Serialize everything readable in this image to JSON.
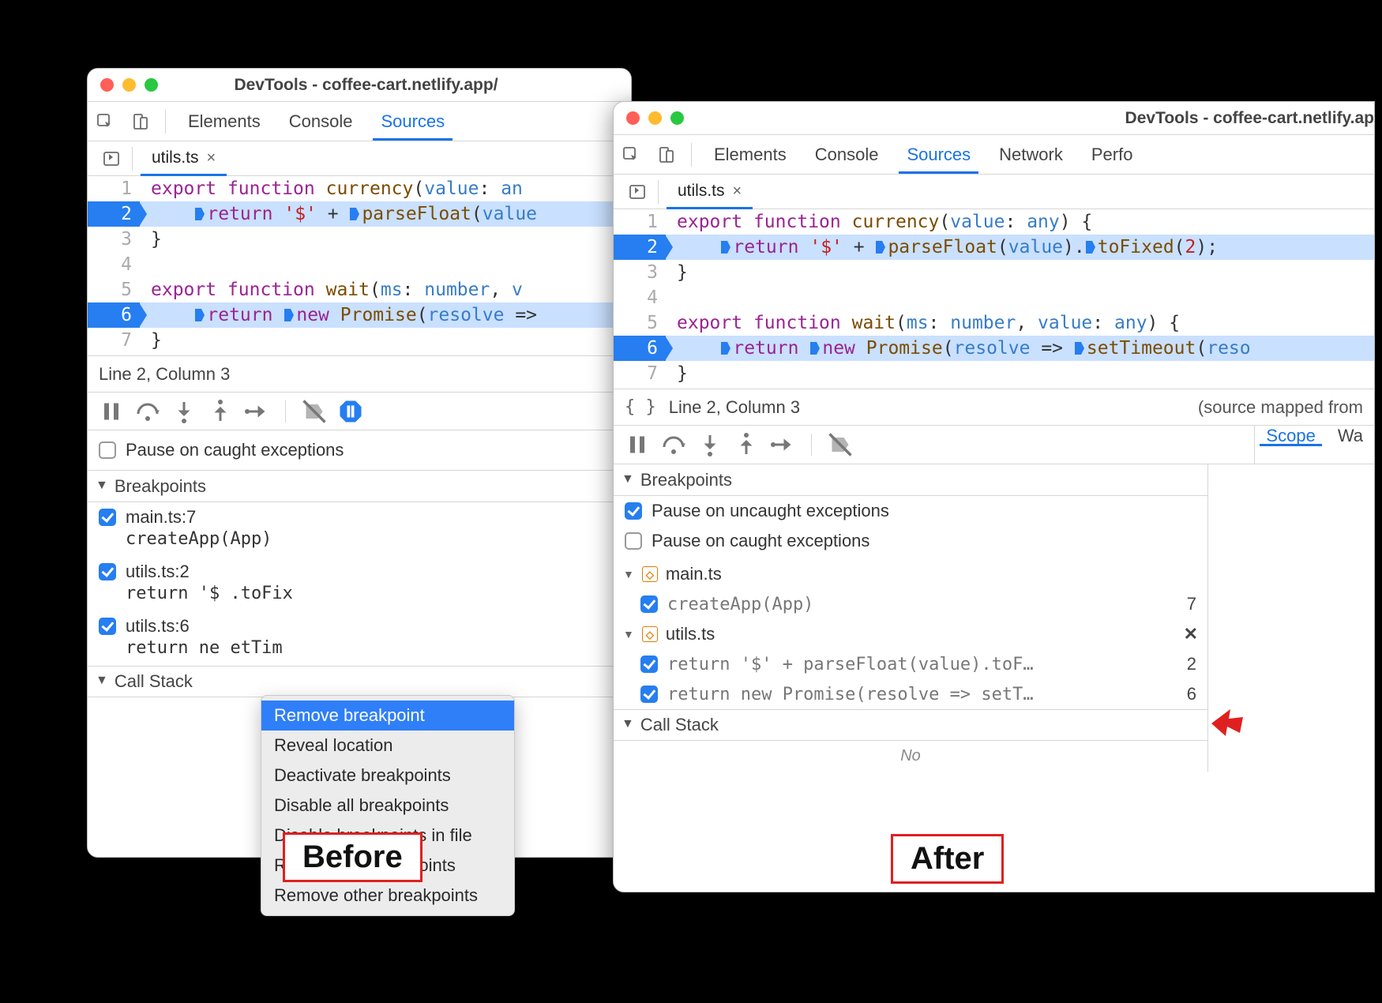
{
  "before": {
    "window_title": "DevTools - coffee-cart.netlify.app/",
    "top_tabs": [
      "Elements",
      "Console",
      "Sources"
    ],
    "active_top_tab": "Sources",
    "file_tab": "utils.ts",
    "code_lines": [
      {
        "n": 1,
        "bp": false,
        "tokens": [
          [
            "kw",
            "export"
          ],
          [
            "pn",
            " "
          ],
          [
            "kw",
            "function"
          ],
          [
            "pn",
            " "
          ],
          [
            "fn",
            "currency"
          ],
          [
            "pn",
            "("
          ],
          [
            "id2",
            "value"
          ],
          [
            "pn",
            ": "
          ],
          [
            "ty",
            "an"
          ]
        ]
      },
      {
        "n": 2,
        "bp": true,
        "tokens": [
          [
            "pn",
            "    "
          ],
          [
            "bpm",
            ""
          ],
          [
            "kw",
            "return"
          ],
          [
            "pn",
            " "
          ],
          [
            "str",
            "'$'"
          ],
          [
            "pn",
            " + "
          ],
          [
            "bpm",
            ""
          ],
          [
            "fn",
            "parseFloat"
          ],
          [
            "pn",
            "("
          ],
          [
            "id2",
            "value"
          ]
        ]
      },
      {
        "n": 3,
        "bp": false,
        "tokens": [
          [
            "pn",
            "}"
          ]
        ]
      },
      {
        "n": 4,
        "bp": false,
        "tokens": [
          [
            "pn",
            ""
          ]
        ]
      },
      {
        "n": 5,
        "bp": false,
        "tokens": [
          [
            "kw",
            "export"
          ],
          [
            "pn",
            " "
          ],
          [
            "kw",
            "function"
          ],
          [
            "pn",
            " "
          ],
          [
            "fn",
            "wait"
          ],
          [
            "pn",
            "("
          ],
          [
            "id2",
            "ms"
          ],
          [
            "pn",
            ": "
          ],
          [
            "ty",
            "number"
          ],
          [
            "pn",
            ", "
          ],
          [
            "id2",
            "v"
          ]
        ]
      },
      {
        "n": 6,
        "bp": true,
        "tokens": [
          [
            "pn",
            "    "
          ],
          [
            "bpm",
            ""
          ],
          [
            "kw",
            "return"
          ],
          [
            "pn",
            " "
          ],
          [
            "bpm",
            ""
          ],
          [
            "kw",
            "new"
          ],
          [
            "pn",
            " "
          ],
          [
            "fn",
            "Promise"
          ],
          [
            "pn",
            "("
          ],
          [
            "id2",
            "resolve"
          ],
          [
            "pn",
            " =>"
          ]
        ]
      },
      {
        "n": 7,
        "bp": false,
        "tokens": [
          [
            "pn",
            "}"
          ]
        ]
      }
    ],
    "status_text": "Line 2, Column 3",
    "pause_caught_label": "Pause on caught exceptions",
    "pause_caught_checked": false,
    "breakpoints_header": "Breakpoints",
    "bp_items": [
      {
        "checked": true,
        "label": "main.ts:7",
        "snippet": "createApp(App)"
      },
      {
        "checked": true,
        "label": "utils.ts:2",
        "snippet": "return '$                           .toFix"
      },
      {
        "checked": true,
        "label": "utils.ts:6",
        "snippet": "return ne                            etTim"
      }
    ],
    "callstack_header": "Call Stack",
    "context_menu": {
      "items": [
        "Remove breakpoint",
        "Reveal location",
        "Deactivate breakpoints",
        "Disable all breakpoints",
        "Disable breakpoints in file",
        "Remove all breakpoints",
        "Remove other breakpoints"
      ],
      "selected": 0
    },
    "box_label": "Before"
  },
  "after": {
    "window_title": "DevTools - coffee-cart.netlify.ap",
    "top_tabs": [
      "Elements",
      "Console",
      "Sources",
      "Network",
      "Perfo"
    ],
    "active_top_tab": "Sources",
    "file_tab": "utils.ts",
    "code_lines": [
      {
        "n": 1,
        "bp": false,
        "tokens": [
          [
            "kw",
            "export"
          ],
          [
            "pn",
            " "
          ],
          [
            "kw",
            "function"
          ],
          [
            "pn",
            " "
          ],
          [
            "fn",
            "currency"
          ],
          [
            "pn",
            "("
          ],
          [
            "id2",
            "value"
          ],
          [
            "pn",
            ": "
          ],
          [
            "ty",
            "any"
          ],
          [
            "pn",
            ") {"
          ]
        ]
      },
      {
        "n": 2,
        "bp": true,
        "tokens": [
          [
            "pn",
            "    "
          ],
          [
            "bpm",
            ""
          ],
          [
            "kw",
            "return"
          ],
          [
            "pn",
            " "
          ],
          [
            "str",
            "'$'"
          ],
          [
            "pn",
            " + "
          ],
          [
            "bpm",
            ""
          ],
          [
            "fn",
            "parseFloat"
          ],
          [
            "pn",
            "("
          ],
          [
            "id2",
            "value"
          ],
          [
            "pn",
            ")."
          ],
          [
            "bpm",
            ""
          ],
          [
            "fn",
            "toFixed"
          ],
          [
            "pn",
            "("
          ],
          [
            "num",
            "2"
          ],
          [
            "pn",
            ");"
          ]
        ]
      },
      {
        "n": 3,
        "bp": false,
        "tokens": [
          [
            "pn",
            "}"
          ]
        ]
      },
      {
        "n": 4,
        "bp": false,
        "tokens": [
          [
            "pn",
            ""
          ]
        ]
      },
      {
        "n": 5,
        "bp": false,
        "tokens": [
          [
            "kw",
            "export"
          ],
          [
            "pn",
            " "
          ],
          [
            "kw",
            "function"
          ],
          [
            "pn",
            " "
          ],
          [
            "fn",
            "wait"
          ],
          [
            "pn",
            "("
          ],
          [
            "id2",
            "ms"
          ],
          [
            "pn",
            ": "
          ],
          [
            "ty",
            "number"
          ],
          [
            "pn",
            ", "
          ],
          [
            "id2",
            "value"
          ],
          [
            "pn",
            ": "
          ],
          [
            "ty",
            "any"
          ],
          [
            "pn",
            ") {"
          ]
        ]
      },
      {
        "n": 6,
        "bp": true,
        "tokens": [
          [
            "pn",
            "    "
          ],
          [
            "bpm",
            ""
          ],
          [
            "kw",
            "return"
          ],
          [
            "pn",
            " "
          ],
          [
            "bpm",
            ""
          ],
          [
            "kw",
            "new"
          ],
          [
            "pn",
            " "
          ],
          [
            "fn",
            "Promise"
          ],
          [
            "pn",
            "("
          ],
          [
            "id2",
            "resolve"
          ],
          [
            "pn",
            " => "
          ],
          [
            "bpm",
            ""
          ],
          [
            "fn",
            "setTimeout"
          ],
          [
            "pn",
            "("
          ],
          [
            "id2",
            "reso"
          ]
        ]
      },
      {
        "n": 7,
        "bp": false,
        "tokens": [
          [
            "pn",
            "}"
          ]
        ]
      }
    ],
    "pp_symbol": "{ }",
    "status_text": "Line 2, Column 3",
    "status_right": "(source mapped from",
    "breakpoints_header": "Breakpoints",
    "pause_uncaught_label": "Pause on uncaught exceptions",
    "pause_uncaught_checked": true,
    "pause_caught_label": "Pause on caught exceptions",
    "pause_caught_checked": false,
    "groups": [
      {
        "file": "main.ts",
        "lines": [
          {
            "checked": true,
            "snippet": "createApp(App)",
            "ln": "7"
          }
        ],
        "show_x": false
      },
      {
        "file": "utils.ts",
        "lines": [
          {
            "checked": true,
            "snippet": "return '$' + parseFloat(value).toF…",
            "ln": "2"
          },
          {
            "checked": true,
            "snippet": "return new Promise(resolve => setT…",
            "ln": "6"
          }
        ],
        "show_x": true
      }
    ],
    "callstack_header": "Call Stack",
    "scope_tab": "Scope",
    "watch_tab": "Wa",
    "box_label": "After"
  }
}
